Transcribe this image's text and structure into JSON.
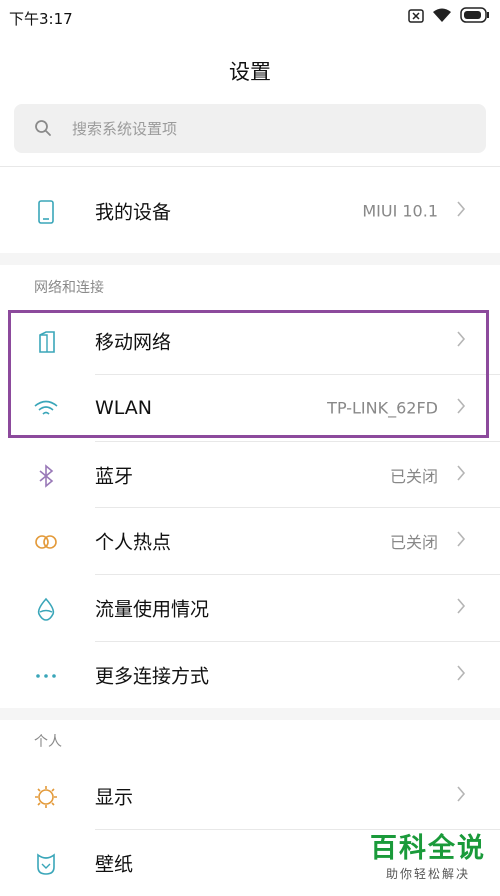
{
  "status_bar": {
    "time": "下午3:17",
    "battery_icon": "battery-icon",
    "wifi_icon": "wifi-icon",
    "sim_icon": "no-sim-icon"
  },
  "page": {
    "title": "设置"
  },
  "search": {
    "placeholder": "搜索系统设置项",
    "icon": "search-icon"
  },
  "my_device": {
    "label": "我的设备",
    "value": "MIUI 10.1",
    "icon": "phone-icon"
  },
  "sections": {
    "network": {
      "header": "网络和连接",
      "items": [
        {
          "label": "移动网络",
          "value": "",
          "icon": "sim-card-icon"
        },
        {
          "label": "WLAN",
          "value": "TP-LINK_62FD",
          "icon": "wifi-icon"
        },
        {
          "label": "蓝牙",
          "value": "已关闭",
          "icon": "bluetooth-icon"
        },
        {
          "label": "个人热点",
          "value": "已关闭",
          "icon": "hotspot-icon"
        },
        {
          "label": "流量使用情况",
          "value": "",
          "icon": "data-usage-icon"
        },
        {
          "label": "更多连接方式",
          "value": "",
          "icon": "more-dots-icon"
        }
      ]
    },
    "personal": {
      "header": "个人",
      "items": [
        {
          "label": "显示",
          "value": "",
          "icon": "display-icon"
        },
        {
          "label": "壁纸",
          "value": "",
          "icon": "wallpaper-icon"
        }
      ]
    }
  },
  "watermark": {
    "title": "百科全说",
    "subtitle": "助你轻松解决"
  },
  "colors": {
    "accent": "#3aa6b9",
    "highlight_border": "#8c4a9c",
    "watermark_green": "#1a9a3a"
  }
}
